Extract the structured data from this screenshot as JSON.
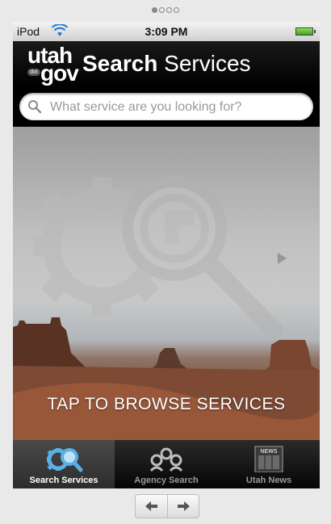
{
  "page_indicator": {
    "pages": 4,
    "active": 0
  },
  "status_bar": {
    "carrier": "iPod",
    "time": "3:09 PM"
  },
  "header": {
    "logo_top": "utah",
    "logo_bottom": "gov",
    "logo_tag": "dot",
    "title_bold": "Search",
    "title_light": " Services"
  },
  "search": {
    "placeholder": "What service are you looking for?",
    "value": ""
  },
  "hero": {
    "cta": "TAP TO BROWSE SERVICES"
  },
  "tabs": [
    {
      "label": "Search Services",
      "icon": "gear-search-icon",
      "active": true
    },
    {
      "label": "Agency Search",
      "icon": "agency-people-icon",
      "active": false
    },
    {
      "label": "Utah News",
      "icon": "newspaper-icon",
      "badge": "NEWS",
      "active": false
    }
  ],
  "colors": {
    "active_tab_icon": "#5ab0e8",
    "battery": "#5ccb2e"
  }
}
